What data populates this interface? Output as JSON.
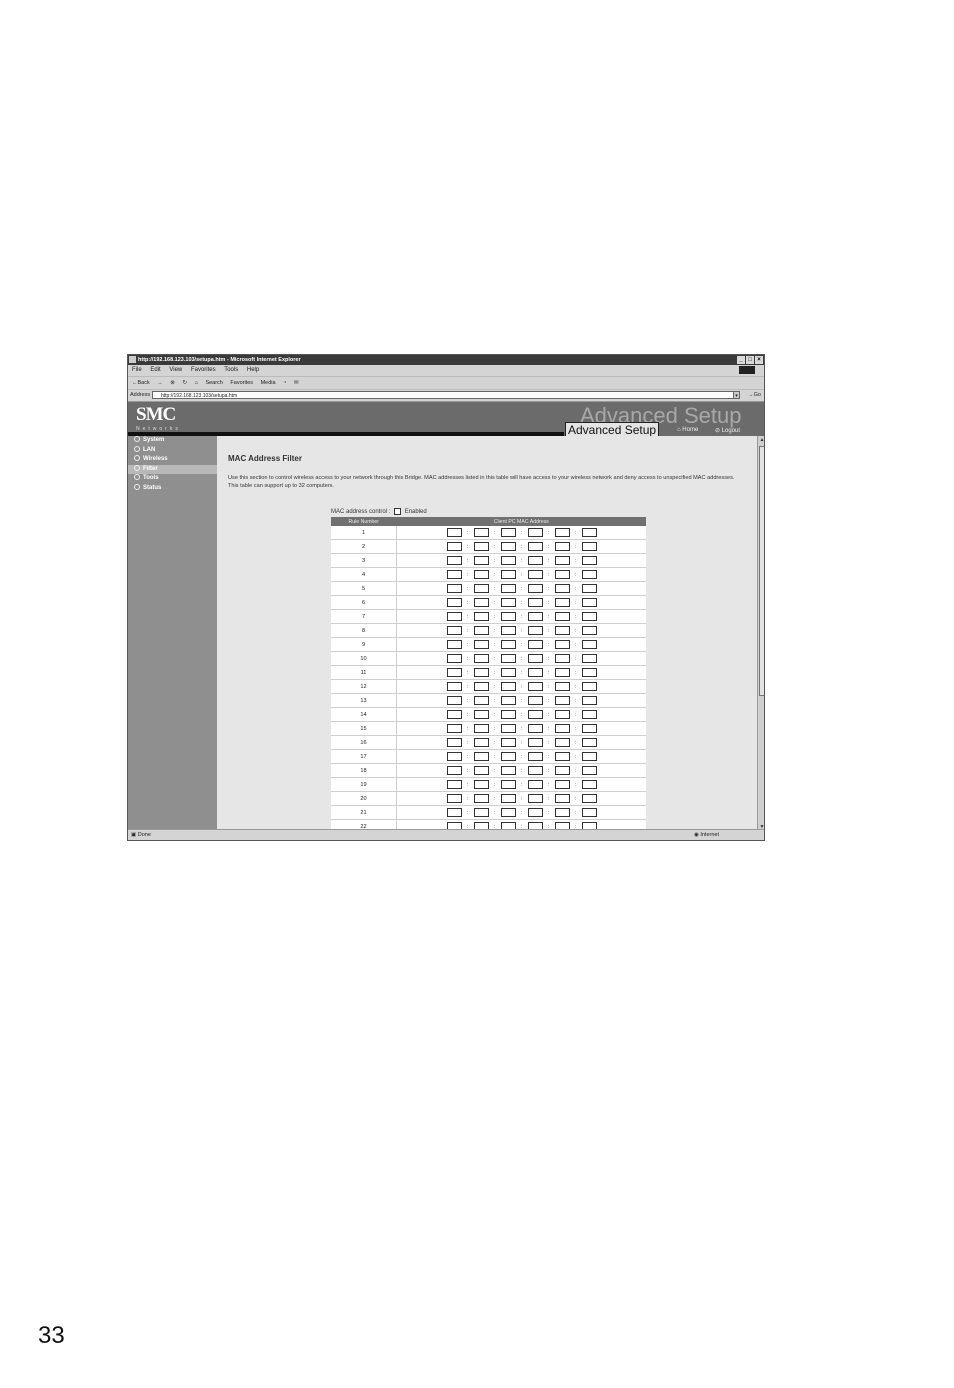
{
  "window": {
    "title": "http://192.168.123.103/setupa.htm - Microsoft Internet Explorer",
    "controls": [
      "_",
      "□",
      "×"
    ]
  },
  "menu": [
    "File",
    "Edit",
    "View",
    "Favorites",
    "Tools",
    "Help"
  ],
  "toolbar": {
    "back": "←Back",
    "forward": "→",
    "search": "Search",
    "favorites": "Favorites",
    "media": "Media"
  },
  "address": {
    "label": "Address",
    "value": "http://192.168.123.103/setupa.htm",
    "go": "Go"
  },
  "header": {
    "logo": "SMC",
    "logo_sub": "Networks",
    "faded_title": "Advanced Setup",
    "section_label": "Advanced Setup",
    "home": "Home",
    "logout": "Logout"
  },
  "sidebar": {
    "items": [
      {
        "label": "System"
      },
      {
        "label": "LAN"
      },
      {
        "label": "Wireless"
      },
      {
        "label": "Filter"
      },
      {
        "label": "Tools"
      },
      {
        "label": "Status"
      }
    ],
    "active_index": 3
  },
  "content": {
    "title": "MAC Address Filter",
    "description": "Use this section to control wireless access to your network through this Bridge. MAC addresses listed in this table will have access to your wireless network and deny access to unspecified MAC addresses. This table can support up to 32 computers.",
    "control_label": "MAC address control :",
    "enabled_label": "Enabled",
    "table": {
      "headers": [
        "Rule Number",
        "Client PC MAC Address"
      ],
      "separator": ":",
      "rows": [
        "1",
        "2",
        "3",
        "4",
        "5",
        "6",
        "7",
        "8",
        "9",
        "10",
        "11",
        "12",
        "13",
        "14",
        "15",
        "16",
        "17",
        "18",
        "19",
        "20",
        "21",
        "22"
      ]
    }
  },
  "status": {
    "left": "Done",
    "right": "Internet"
  },
  "page_number": "33"
}
